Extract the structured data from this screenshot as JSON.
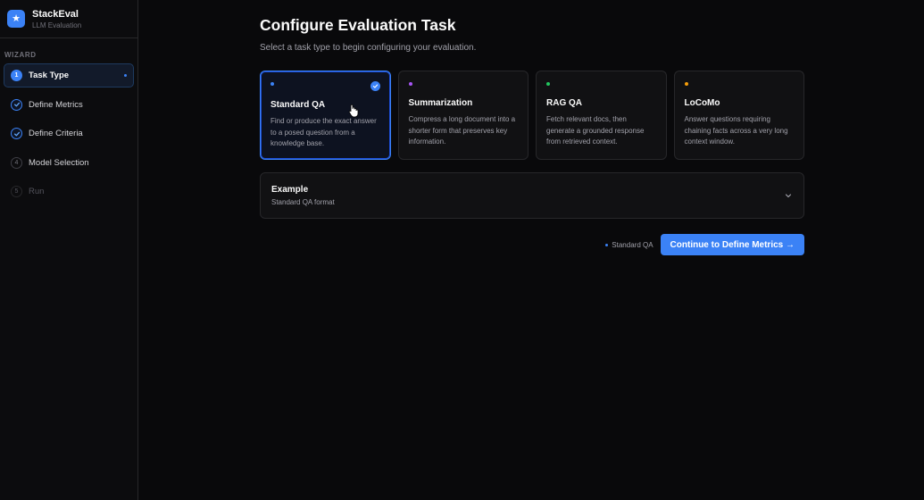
{
  "brand": {
    "name": "StackEval",
    "subtitle": "LLM Evaluation",
    "logo_icon": "star-icon",
    "accent": "#3b82f6"
  },
  "sidebar": {
    "section_label": "WIZARD",
    "steps": [
      {
        "number": "1",
        "label": "Task Type",
        "state": "active"
      },
      {
        "number": "2",
        "label": "Define Metrics",
        "state": "done"
      },
      {
        "number": "3",
        "label": "Define Criteria",
        "state": "done"
      },
      {
        "number": "4",
        "label": "Model Selection",
        "state": "pending"
      },
      {
        "number": "5",
        "label": "Run",
        "state": "disabled"
      }
    ]
  },
  "main": {
    "title": "Configure Evaluation Task",
    "subtitle": "Select a task type to begin configuring your evaluation.",
    "cards": [
      {
        "title": "Standard QA",
        "description": "Find or produce the exact answer to a posed question from a knowledge base.",
        "dot_color": "#3b82f6",
        "selected": true
      },
      {
        "title": "Summarization",
        "description": "Compress a long document into a shorter form that preserves key information.",
        "dot_color": "#a855f7",
        "selected": false
      },
      {
        "title": "RAG QA",
        "description": "Fetch relevant docs, then generate a grounded response from retrieved context.",
        "dot_color": "#22c55e",
        "selected": false
      },
      {
        "title": "LoCoMo",
        "description": "Answer questions requiring chaining facts across a very long context window.",
        "dot_color": "#f59e0b",
        "selected": false
      }
    ],
    "example": {
      "title": "Example",
      "subtitle": "Standard QA format"
    },
    "footer": {
      "selected_tag": "Standard QA",
      "continue_label": "Continue to Define Metrics →"
    }
  }
}
